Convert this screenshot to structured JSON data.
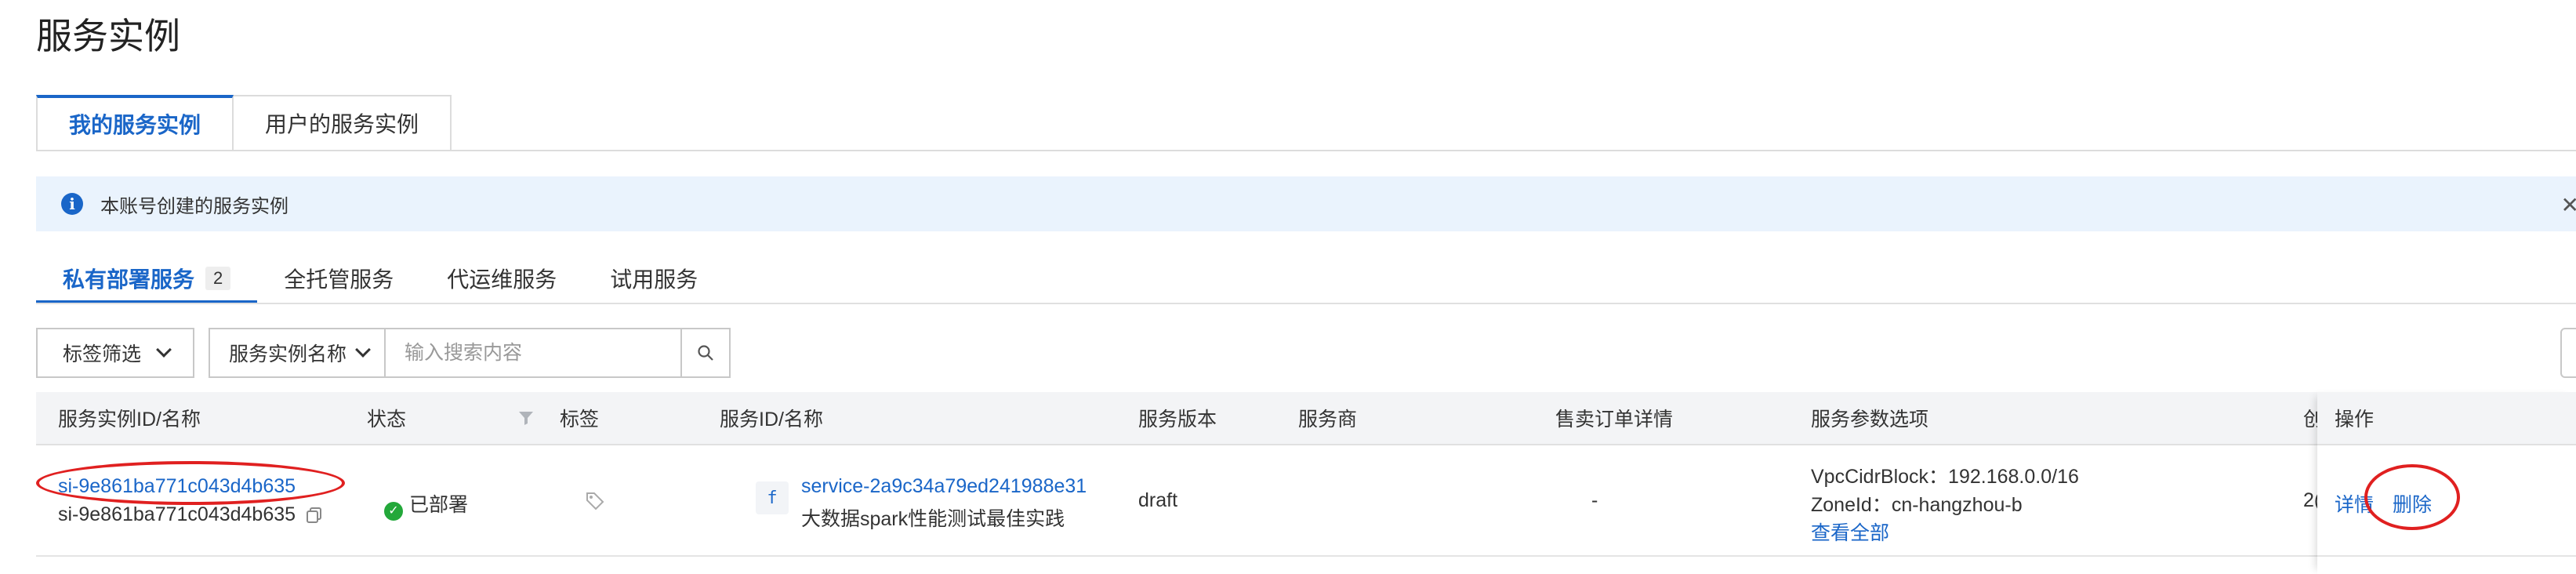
{
  "page": {
    "title": "服务实例"
  },
  "top_tabs": [
    {
      "label": "我的服务实例",
      "active": true
    },
    {
      "label": "用户的服务实例",
      "active": false
    }
  ],
  "banner": {
    "text": "本账号创建的服务实例",
    "icon": "info-icon"
  },
  "sub_tabs": [
    {
      "label": "私有部署服务",
      "count": "2",
      "active": true
    },
    {
      "label": "全托管服务"
    },
    {
      "label": "代运维服务"
    },
    {
      "label": "试用服务"
    }
  ],
  "filters": {
    "tag_filter": "标签筛选",
    "search_field": "服务实例名称",
    "search_placeholder": "输入搜索内容"
  },
  "table": {
    "columns": [
      "服务实例ID/名称",
      "状态",
      "标签",
      "服务ID/名称",
      "服务版本",
      "服务商",
      "售卖订单详情",
      "服务参数选项",
      "创",
      "操作"
    ],
    "rows": [
      {
        "instance_id": "si-9e861ba771c043d4b635",
        "instance_name": "si-9e861ba771c043d4b635",
        "status": "已部署",
        "service_icon_letter": "f",
        "service_id": "service-2a9c34a79ed241988e31",
        "service_name": "大数据spark性能测试最佳实践",
        "version": "draft",
        "vendor": "",
        "order_details": "-",
        "params": [
          "VpcCidrBlock：192.168.0.0/16",
          "ZoneId：cn-hangzhou-b"
        ],
        "params_more": "查看全部",
        "created_partial": "2(",
        "actions": {
          "detail": "详情",
          "delete": "删除"
        }
      }
    ]
  },
  "colors": {
    "accent": "#1a66c8",
    "success": "#23a83a",
    "annotation": "#e02020",
    "banner_bg": "#eaf3fd"
  }
}
